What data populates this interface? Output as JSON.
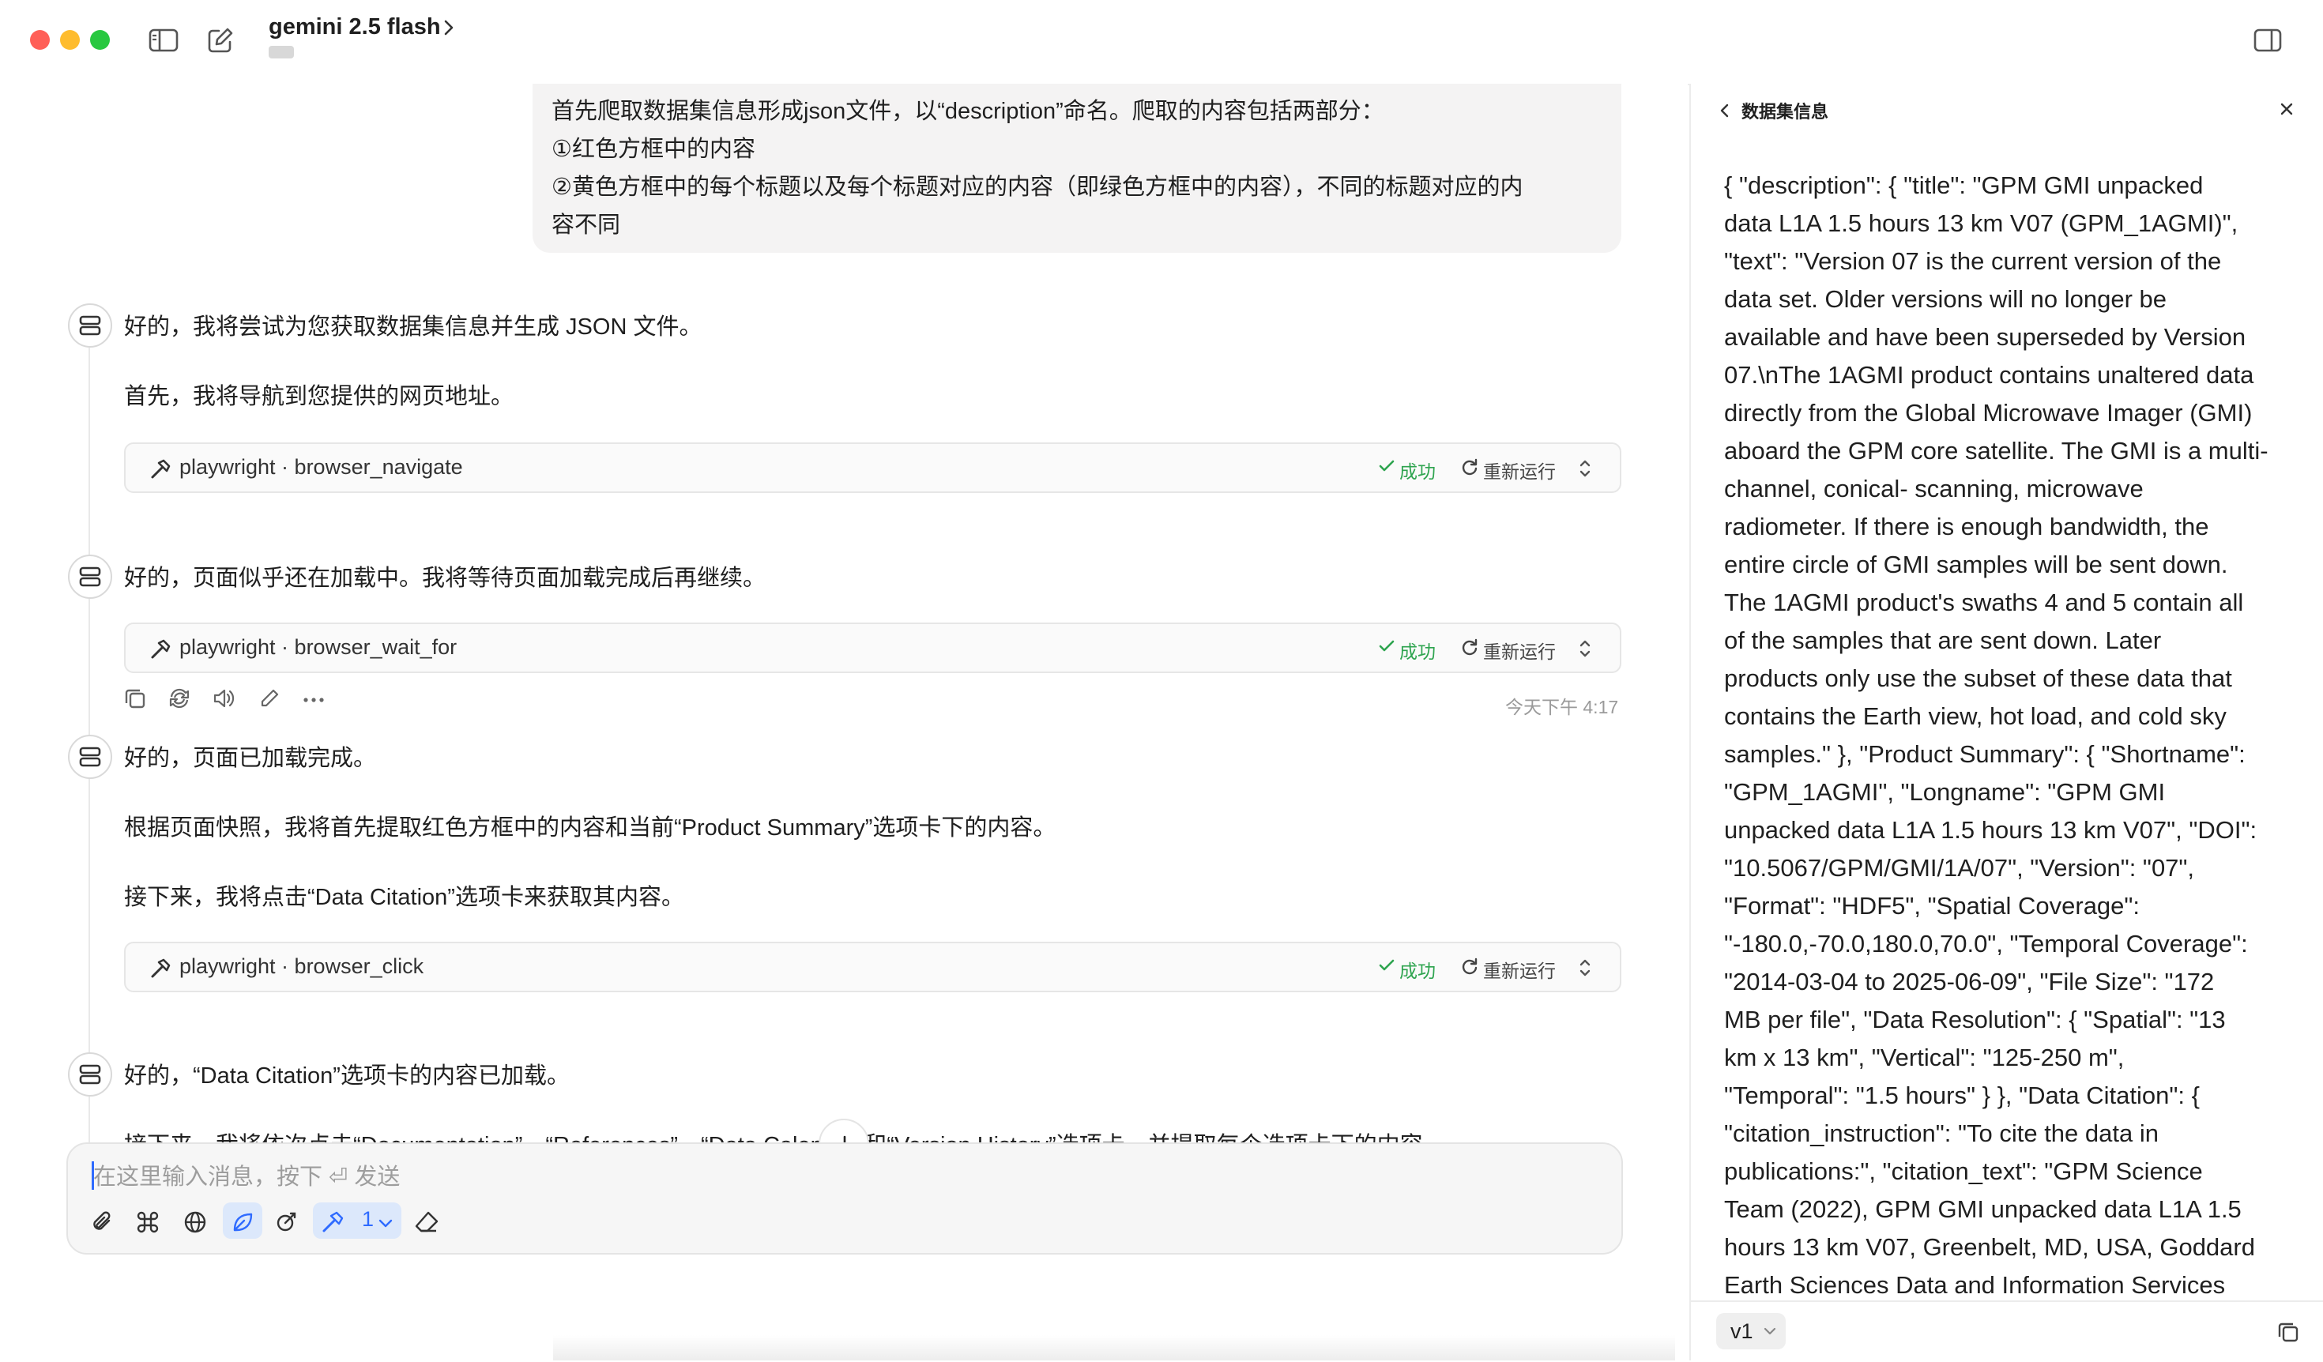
{
  "window": {
    "model_title": "gemini 2.5 flash"
  },
  "user_message": {
    "lines": [
      "首先爬取数据集信息形成json文件，以“description”命名。爬取的内容包括两部分：",
      "①红色方框中的内容",
      "②黄色方框中的每个标题以及每个标题对应的内容（即绿色方框中的内容），不同的标题对应的内",
      "容不同"
    ]
  },
  "assistant": {
    "msg1_line1": "好的，我将尝试为您获取数据集信息并生成 JSON 文件。",
    "msg1_line2": "首先，我将导航到您提供的网页地址。",
    "tool1": {
      "label": "playwright · browser_navigate",
      "status": "成功",
      "rerun": "重新运行"
    },
    "msg2_line1": "好的，页面似乎还在加载中。我将等待页面加载完成后再继续。",
    "tool2": {
      "label": "playwright · browser_wait_for",
      "status": "成功",
      "rerun": "重新运行"
    },
    "timestamp": "今天下午 4:17",
    "msg3_line1": "好的，页面已加载完成。",
    "msg3_line2": "根据页面快照，我将首先提取红色方框中的内容和当前“Product Summary”选项卡下的内容。",
    "msg3_line3": "接下来，我将点击“Data Citation”选项卡来获取其内容。",
    "tool3": {
      "label": "playwright · browser_click",
      "status": "成功",
      "rerun": "重新运行"
    },
    "msg4_line1": "好的，“Data Citation”选项卡的内容已加载。",
    "msg4_line2": "接下来，我将依次点击“Documentation”、“References”、“Data Calendar”和“Version History”选项卡，并提取每个选项卡下的内容。"
  },
  "composer": {
    "placeholder": "在这里输入消息，按下 ⏎ 发送",
    "tool_count": "1"
  },
  "side_panel": {
    "title": "数据集信息",
    "lines": [
      "{ \"description\": { \"title\": \"GPM GMI unpacked",
      "data L1A 1.5 hours 13 km V07 (GPM_1AGMI)\",",
      "\"text\": \"Version 07 is the current version of the",
      "data set. Older versions will no longer be",
      "available and have been superseded by Version",
      "07.\\nThe 1AGMI product contains unaltered data",
      "directly from the Global Microwave Imager (GMI)",
      "aboard the GPM core satellite. The GMI is a multi-",
      "channel, conical- scanning, microwave",
      "radiometer. If there is enough bandwidth, the",
      "entire circle of GMI samples will be sent down.",
      "The 1AGMI product's swaths 4 and 5 contain all",
      "of the samples that are sent down. Later",
      "products only use the subset of these data that",
      "contains the Earth view, hot load, and cold sky",
      "samples.\" }, \"Product Summary\": { \"Shortname\":",
      "\"GPM_1AGMI\", \"Longname\": \"GPM GMI",
      "unpacked data L1A 1.5 hours 13 km V07\", \"DOI\":",
      "\"10.5067/GPM/GMI/1A/07\", \"Version\": \"07\",",
      "\"Format\": \"HDF5\", \"Spatial Coverage\":",
      "\"-180.0,-70.0,180.0,70.0\", \"Temporal Coverage\":",
      "\"2014-03-04 to 2025-06-09\", \"File Size\": \"172",
      "MB per file\", \"Data Resolution\": { \"Spatial\": \"13",
      "km x 13 km\", \"Vertical\": \"125-250 m\",",
      "\"Temporal\": \"1.5 hours\" } }, \"Data Citation\": {",
      "\"citation_instruction\": \"To cite the data in",
      "publications:\", \"citation_text\": \"GPM Science",
      "Team (2022), GPM GMI unpacked data L1A 1.5",
      "hours 13 km V07, Greenbelt, MD, USA, Goddard",
      "Earth Sciences Data and Information Services"
    ],
    "version": "v1"
  },
  "colors": {
    "success": "#2ea44f",
    "accent": "#2f6bff",
    "traffic_red": "#ff5f57",
    "traffic_yellow": "#febc2e",
    "traffic_green": "#28c840"
  }
}
